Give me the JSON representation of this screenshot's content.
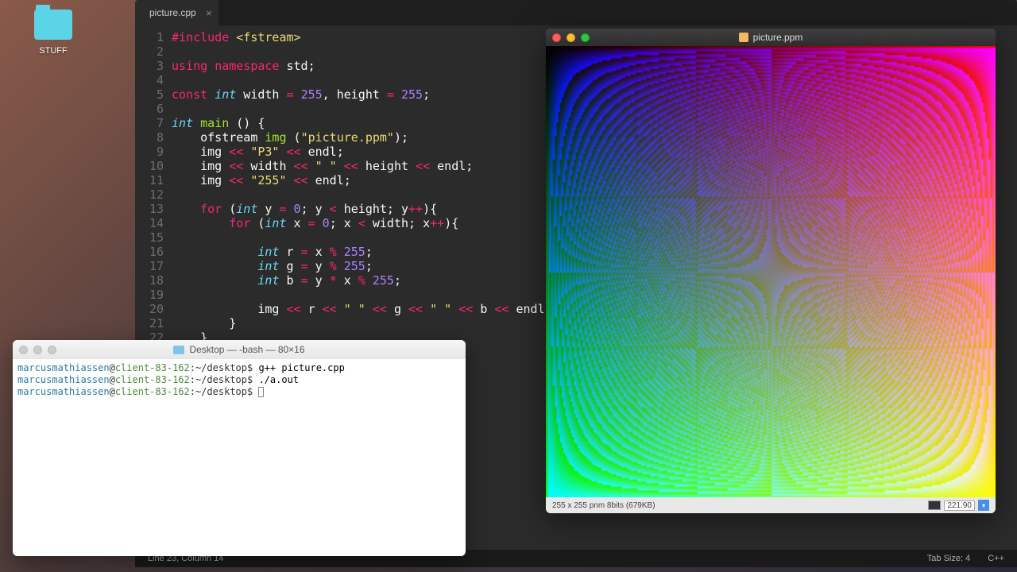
{
  "desktop": {
    "folder_label": "STUFF"
  },
  "editor": {
    "tab_name": "picture.cpp",
    "status_left": "Line 23, Column 14",
    "status_tabsize": "Tab Size: 4",
    "status_lang": "C++",
    "line_count": 22
  },
  "terminal": {
    "title": "Desktop — -bash — 80×16",
    "user": "marcusmathiassen",
    "host": "client-83-162",
    "path": "~/desktop",
    "prompt": "$",
    "commands": [
      "g++ picture.cpp",
      "./a.out",
      ""
    ]
  },
  "viewer": {
    "title": "picture.ppm",
    "status": "255 x 255  pnm  8bits (679KB)",
    "zoom": "221.90"
  }
}
